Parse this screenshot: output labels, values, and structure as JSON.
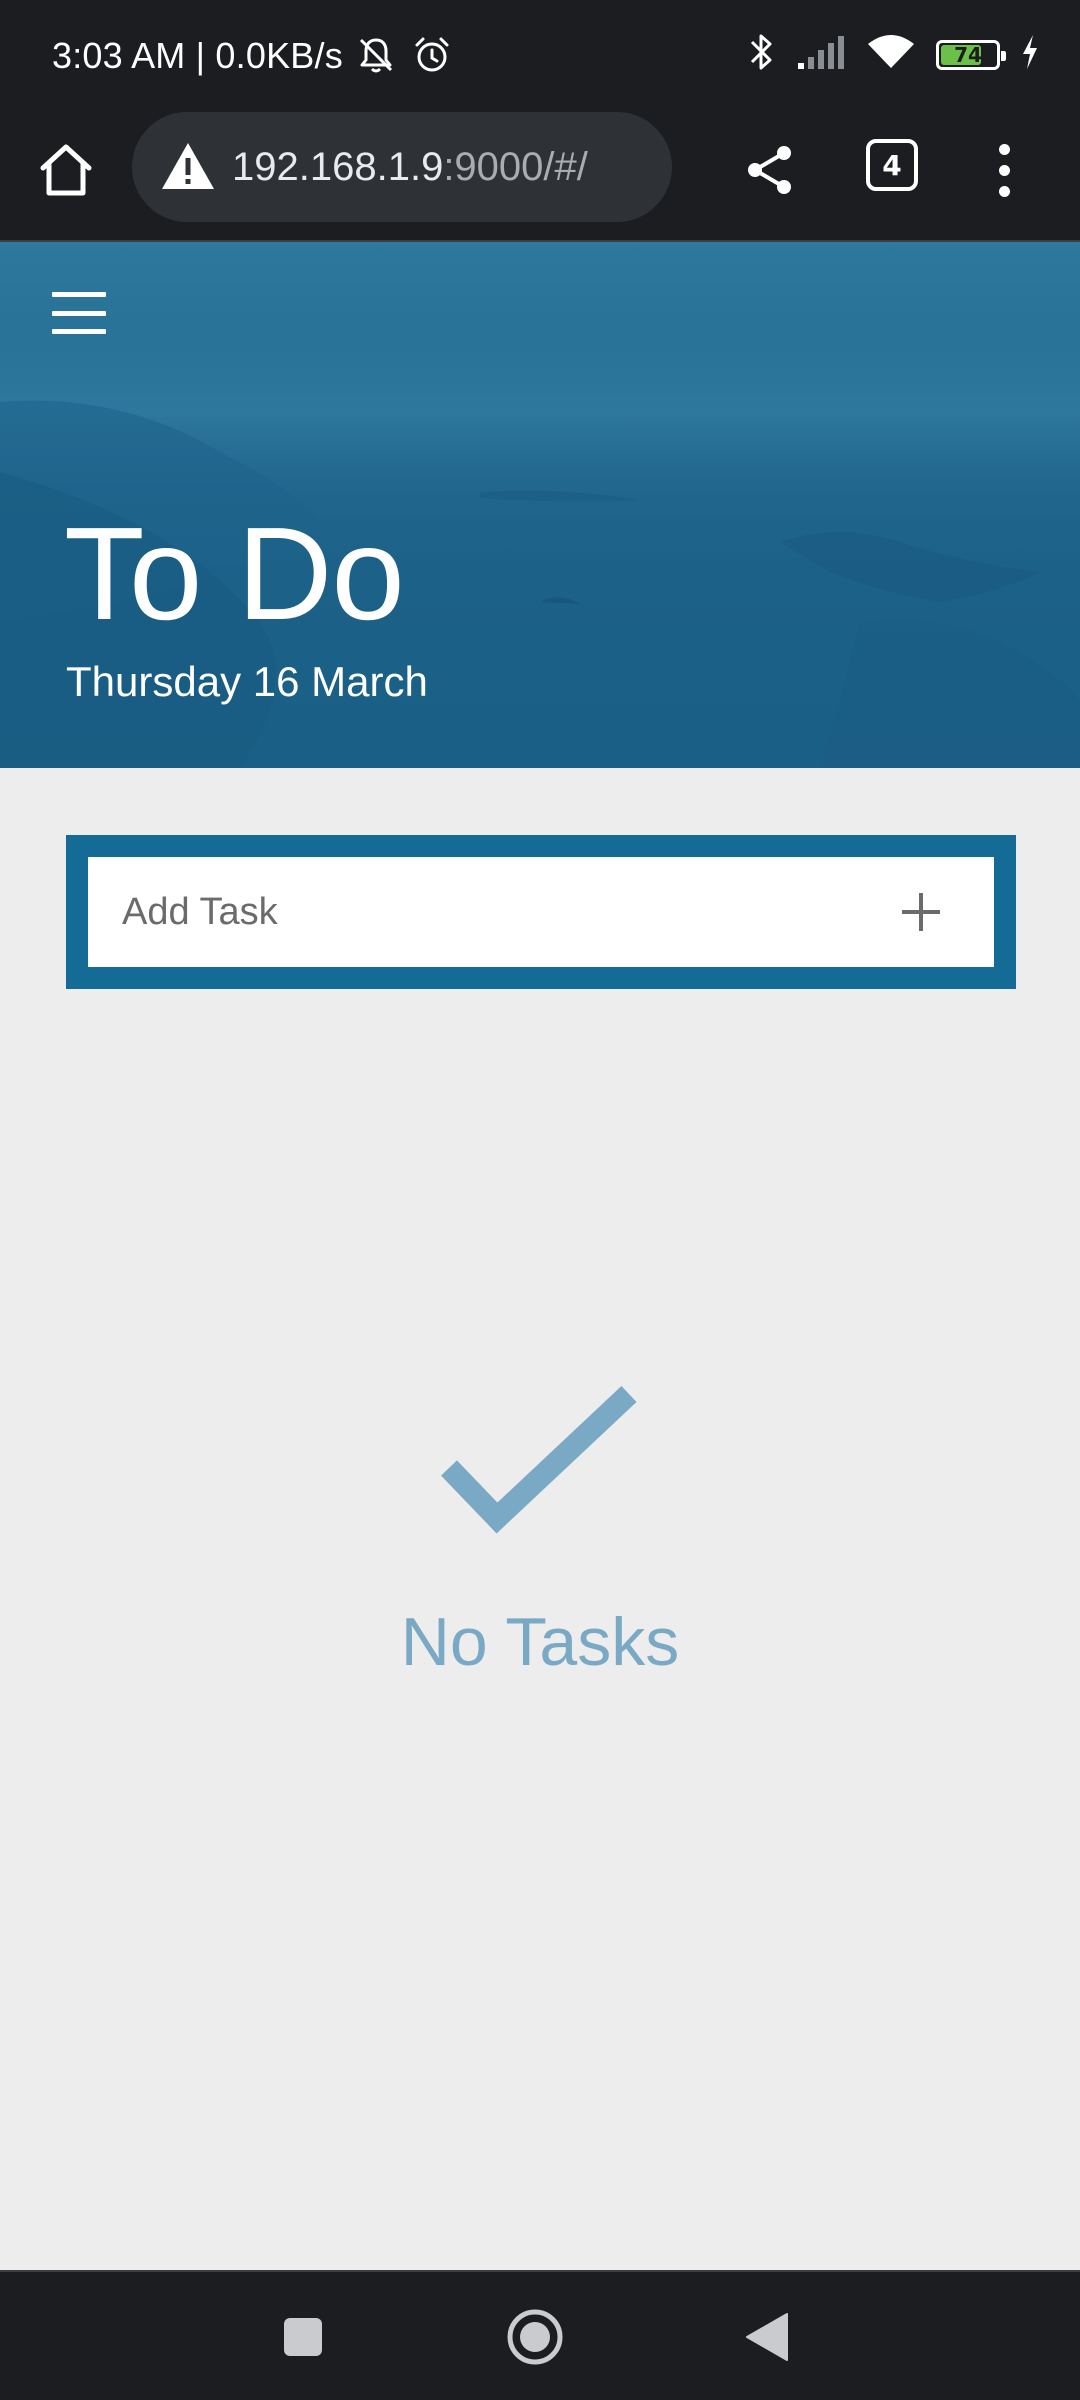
{
  "status_bar": {
    "time_text": "3:03 AM | 0.0KB/s",
    "battery_level": "74",
    "battery_fraction": 0.74,
    "icons": [
      "mute-bell-icon",
      "alarm-icon",
      "bluetooth-icon",
      "signal-icon",
      "wifi-icon",
      "battery-icon",
      "charging-icon"
    ]
  },
  "browser": {
    "url_host": "192.168.1.9",
    "url_rest": ":9000/#/",
    "tab_count": "4",
    "icons": [
      "home-icon",
      "warning-icon",
      "share-icon",
      "tabs-icon",
      "more-icon"
    ]
  },
  "header": {
    "title": "To Do",
    "date": "Thursday 16 March",
    "menu_icon": "hamburger-menu-icon"
  },
  "add_task": {
    "placeholder": "Add Task",
    "value": "",
    "button_icon": "plus-icon"
  },
  "empty_state": {
    "icon": "checkmark-icon",
    "label": "No Tasks"
  },
  "nav_bar": {
    "icons": [
      "recents-icon",
      "home-circle-icon",
      "back-icon"
    ]
  },
  "colors": {
    "system_bar": "#1b1d20",
    "hero_blue": "#1c6188",
    "accent_blue": "#136b96",
    "empty_state_blue": "#7aa9c5",
    "background": "#ededed"
  }
}
